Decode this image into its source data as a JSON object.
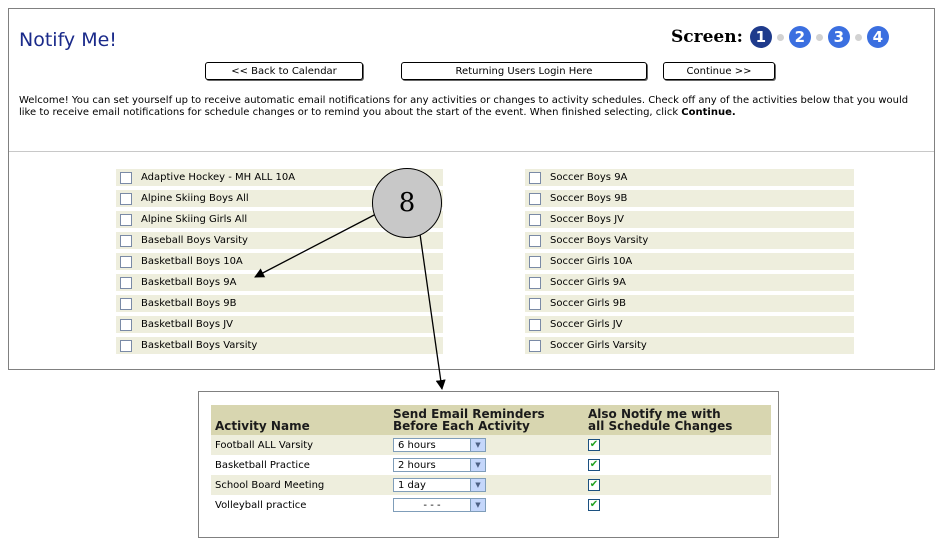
{
  "header": {
    "title": "Notify Me!",
    "screen_label": "Screen:",
    "steps": [
      {
        "label": "1",
        "color": "#1f3b8c"
      },
      {
        "label": "2",
        "color": "#3b6fe0"
      },
      {
        "label": "3",
        "color": "#3b6fe0"
      },
      {
        "label": "4",
        "color": "#3b6fe0"
      }
    ]
  },
  "buttons": {
    "back": "<< Back to Calendar",
    "login": "Returning Users Login Here",
    "continue": "Continue >>"
  },
  "intro": {
    "text": "Welcome! You can set yourself up to receive automatic email notifications for any activities or changes to activity schedules. Check off any of the activities below that you would like to receive email notifications for schedule changes or to remind you about the start of the event. When finished selecting, click ",
    "bold": "Continue."
  },
  "activities_left": [
    "Adaptive Hockey - MH ALL 10A",
    "Alpine Skiing Boys All",
    "Alpine Skiing Girls All",
    "Baseball Boys Varsity",
    "Basketball Boys 10A",
    "Basketball Boys 9A",
    "Basketball Boys 9B",
    "Basketball Boys JV",
    "Basketball Boys Varsity"
  ],
  "activities_right": [
    "Soccer Boys 9A",
    "Soccer Boys 9B",
    "Soccer Boys JV",
    "Soccer Boys Varsity",
    "Soccer Girls 10A",
    "Soccer Girls 9A",
    "Soccer Girls 9B",
    "Soccer Girls JV",
    "Soccer Girls Varsity"
  ],
  "callout": {
    "number": "8"
  },
  "popup": {
    "col_activity": "Activity Name",
    "col_reminder_1": "Send Email Reminders",
    "col_reminder_2": "Before Each Activity",
    "col_notify_1": "Also Notify me with",
    "col_notify_2": "all Schedule Changes",
    "rows": [
      {
        "name": "Football ALL Varsity",
        "reminder": "6 hours",
        "notify": true
      },
      {
        "name": "Basketball Practice",
        "reminder": "2 hours",
        "notify": true
      },
      {
        "name": "School Board Meeting",
        "reminder": "1 day",
        "notify": true
      },
      {
        "name": "Volleyball practice",
        "reminder": "- - -",
        "notify": true
      }
    ]
  }
}
